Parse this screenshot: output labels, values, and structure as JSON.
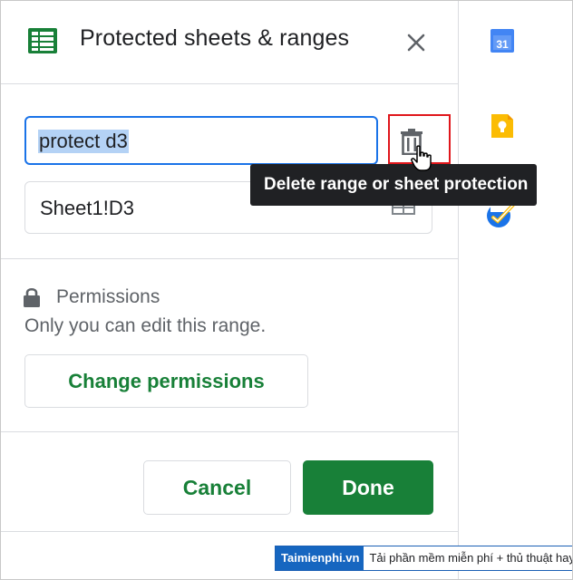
{
  "panel": {
    "title": "Protected sheets & ranges",
    "close_icon": "close-icon",
    "logo_icon": "sheets-logo-icon"
  },
  "range": {
    "description_value": "protect d3",
    "range_value": "Sheet1!D3",
    "delete_icon": "trash-icon",
    "select_range_icon": "grid-icon"
  },
  "tooltip": {
    "text": "Delete range or sheet protection"
  },
  "permissions": {
    "title": "Permissions",
    "description": "Only you can edit this range.",
    "change_label": "Change permissions",
    "icon": "lock-icon"
  },
  "footer": {
    "cancel_label": "Cancel",
    "done_label": "Done"
  },
  "side_panel": {
    "calendar_icon": "calendar-icon",
    "calendar_day": "31",
    "keep_icon": "keep-icon",
    "tasks_icon": "tasks-icon"
  },
  "watermark": {
    "brand": "Taimienphi.vn",
    "tagline": "Tải phần mềm miễn phí + thủ thuật hay"
  },
  "colors": {
    "accent_green": "#188038",
    "focus_blue": "#1a73e8",
    "highlight_red": "#e0161b",
    "tooltip_bg": "#202124",
    "selection": "#b4d2f5"
  }
}
